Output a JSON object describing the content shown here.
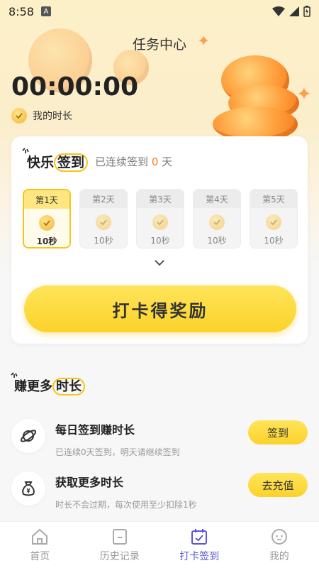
{
  "status": {
    "time": "8:58",
    "notif_glyph": "A"
  },
  "header": {
    "title": "任务中心"
  },
  "timer": {
    "value": "00:00:00",
    "label": "我的时长"
  },
  "signin": {
    "title_plain": "快乐",
    "title_circled": "签到",
    "streak_prefix": "已连续签到",
    "streak_days": "0",
    "streak_suffix": "天",
    "days": [
      {
        "label": "第1天",
        "reward": "10秒",
        "active": true
      },
      {
        "label": "第2天",
        "reward": "10秒",
        "active": false
      },
      {
        "label": "第3天",
        "reward": "10秒",
        "active": false
      },
      {
        "label": "第4天",
        "reward": "10秒",
        "active": false
      },
      {
        "label": "第5天",
        "reward": "10秒",
        "active": false
      }
    ],
    "button": "打卡得奖励"
  },
  "earn": {
    "title_plain": "赚更多",
    "title_circled": "时长",
    "tasks": [
      {
        "name": "每日签到赚时长",
        "desc": "已连续0天签到，明天请继续签到",
        "button": "签到",
        "icon": "planet-icon"
      },
      {
        "name": "获取更多时长",
        "desc": "时长不会过期，每次使用至少扣除1秒",
        "button": "去充值",
        "icon": "money-bag-icon"
      }
    ]
  },
  "nav": {
    "items": [
      {
        "label": "首页",
        "icon": "home-icon"
      },
      {
        "label": "历史记录",
        "icon": "history-icon"
      },
      {
        "label": "打卡签到",
        "icon": "checkin-icon",
        "active": true
      },
      {
        "label": "我的",
        "icon": "profile-icon"
      }
    ]
  },
  "colors": {
    "accent_yellow": "#f5c518",
    "streak_orange": "#ff7a1a",
    "nav_active": "#5b54d6"
  }
}
